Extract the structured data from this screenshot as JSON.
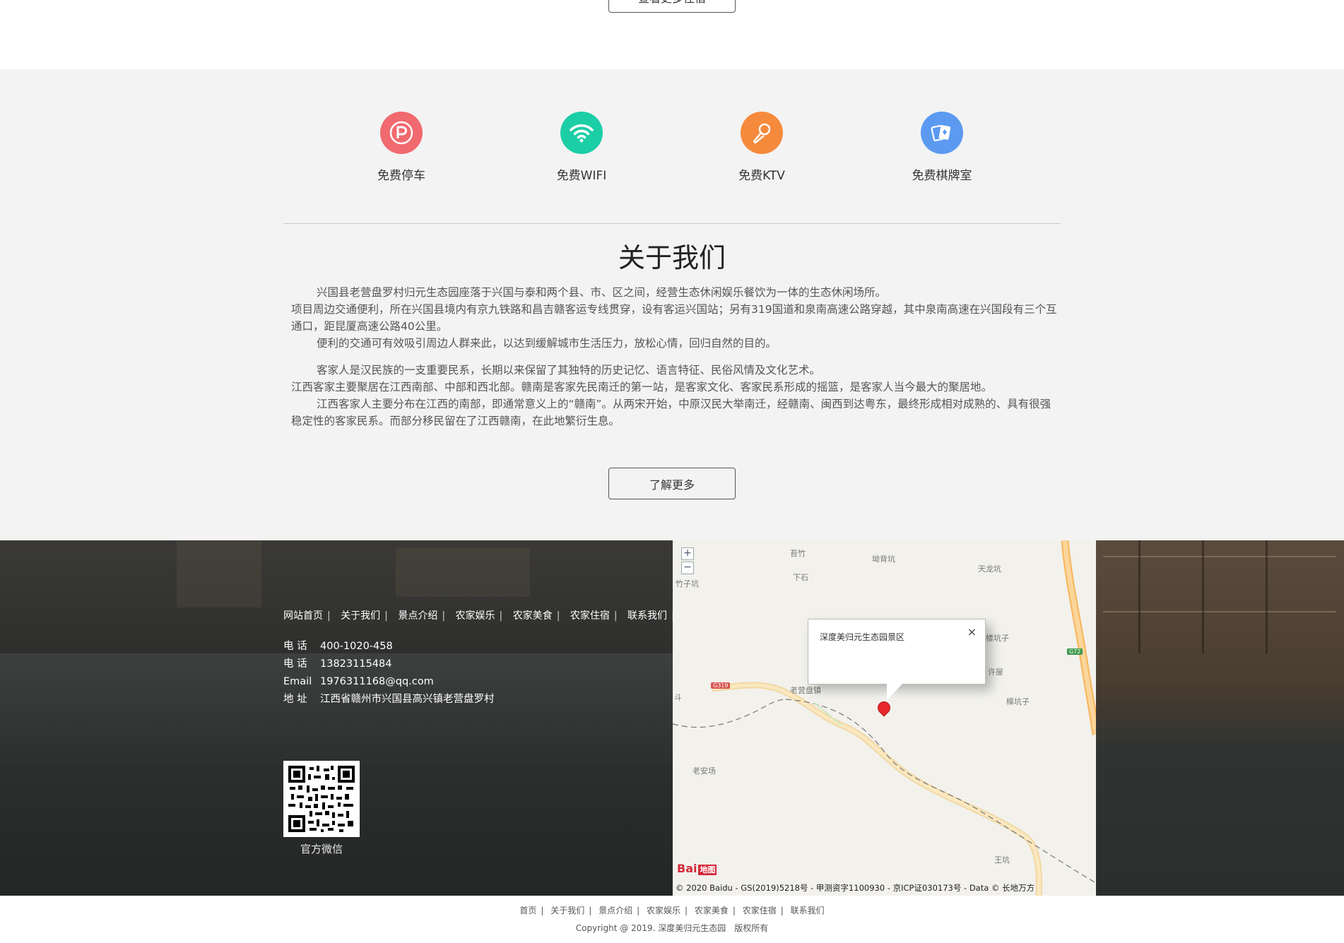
{
  "top_button": {
    "label": "查看更多住宿"
  },
  "features": [
    {
      "label": "免费停车",
      "icon": "parking-icon",
      "color": "#f06a6f"
    },
    {
      "label": "免费WIFI",
      "icon": "wifi-icon",
      "color": "#1ccea6"
    },
    {
      "label": "免费KTV",
      "icon": "microphone-icon",
      "color": "#f58a3c"
    },
    {
      "label": "免费棋牌室",
      "icon": "playing-cards-icon",
      "color": "#5b9af0"
    }
  ],
  "about": {
    "title": "关于我们",
    "paragraphs": [
      "兴国县老营盘罗村归元生态园座落于兴国与泰和两个县、市、区之间，经营生态休闲娱乐餐饮为一体的生态休闲场所。",
      "项目周边交通便利，所在兴国县境内有京九铁路和昌吉赣客运专线贯穿，设有客运兴国站；另有319国道和泉南高速公路穿越，其中泉南高速在兴国段有三个互通口，距昆厦高速公路40公里。",
      "便利的交通可有效吸引周边人群来此，以达到缓解城市生活压力，放松心情，回归自然的目的。",
      "客家人是汉民族的一支重要民系，长期以来保留了其独特的历史记忆、语言特征、民俗风情及文化艺术。",
      "江西客家主要聚居在江西南部、中部和西北部。赣南是客家先民南迁的第一站，是客家文化、客家民系形成的摇篮，是客家人当今最大的聚居地。",
      "江西客家人主要分布在江西的南部，即通常意义上的“赣南”。从两宋开始，中原汉民大举南迁，经赣南、闽西到达粤东，最终形成相对成熟的、具有很强稳定性的客家民系。而部分移民留在了江西赣南，在此地繁衍生息。"
    ],
    "more_button": "了解更多"
  },
  "footer_nav": [
    "网站首页",
    "关于我们",
    "景点介绍",
    "农家娱乐",
    "农家美食",
    "农家住宿",
    "联系我们"
  ],
  "contact": [
    {
      "key": "电 话",
      "value": "400-1020-458"
    },
    {
      "key": "电 话",
      "value": "13823115484"
    },
    {
      "key": "Email",
      "value": "1976311168@qq.com"
    },
    {
      "key": "地 址",
      "value": "江西省赣州市兴国县高兴镇老营盘罗村"
    }
  ],
  "qr": {
    "caption": "官方微信"
  },
  "map": {
    "zoom_in": "+",
    "zoom_out": "−",
    "popup_title": "深度美归元生态园景区",
    "popup_close": "×",
    "places": [
      {
        "label": "苔竹"
      },
      {
        "label": "坳背坑"
      },
      {
        "label": "天龙坑"
      },
      {
        "label": "下石"
      },
      {
        "label": "竹子坑"
      },
      {
        "label": "楼坑子"
      },
      {
        "label": "许屋"
      },
      {
        "label": "樟坑子"
      },
      {
        "label": "老营盘镇"
      },
      {
        "label": "老安场"
      },
      {
        "label": "王坑"
      },
      {
        "label": "斗"
      }
    ],
    "road_g319": "G319",
    "road_g72": "G72",
    "logo_text": "Bai",
    "logo_text2": "地图",
    "copyright": "© 2020 Baidu - GS(2019)5218号 - 甲测资字1100930 - 京ICP证030173号 - Data © 长地万方"
  },
  "bottom_nav": [
    "首页",
    "关于我们",
    "景点介绍",
    "农家娱乐",
    "农家美食",
    "农家住宿",
    "联系我们"
  ],
  "bottom_copyright": {
    "text": "Copyright @ 2019. 深度美归元生态园",
    "rights": "版权所有"
  }
}
